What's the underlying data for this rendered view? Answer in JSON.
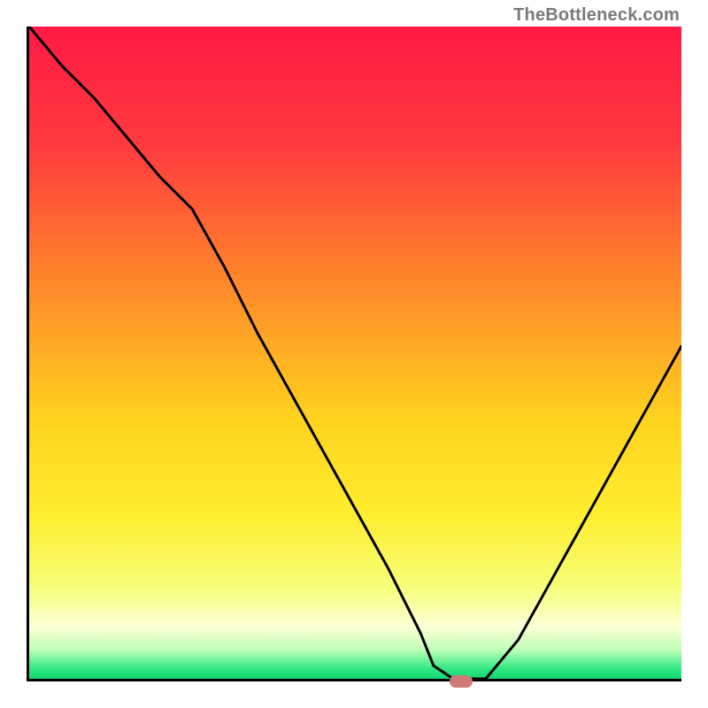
{
  "attribution": "TheBottleneck.com",
  "chart_data": {
    "type": "line",
    "title": "",
    "xlabel": "",
    "ylabel": "",
    "xlim": [
      0,
      100
    ],
    "ylim": [
      0,
      100
    ],
    "x": [
      0,
      5,
      10,
      15,
      20,
      25,
      30,
      35,
      40,
      45,
      50,
      55,
      60,
      62,
      65,
      67,
      70,
      75,
      80,
      85,
      90,
      95,
      100
    ],
    "values": [
      100,
      94,
      89,
      83,
      77,
      72,
      63,
      53,
      44,
      35,
      26,
      17,
      7,
      2,
      0,
      0,
      0,
      6,
      15,
      24,
      33,
      42,
      51
    ],
    "marker": {
      "x": 66,
      "y": 0,
      "color": "#cf7a78"
    },
    "gradient_stops": [
      {
        "offset": 0.0,
        "color": "#ff1a44"
      },
      {
        "offset": 0.18,
        "color": "#ff3a3f"
      },
      {
        "offset": 0.4,
        "color": "#ff8a2a"
      },
      {
        "offset": 0.6,
        "color": "#ffd21e"
      },
      {
        "offset": 0.75,
        "color": "#ffee30"
      },
      {
        "offset": 0.86,
        "color": "#f6ff7a"
      },
      {
        "offset": 0.92,
        "color": "#fdffd6"
      },
      {
        "offset": 0.955,
        "color": "#bfffb7"
      },
      {
        "offset": 0.985,
        "color": "#2fe783"
      },
      {
        "offset": 1.0,
        "color": "#15d871"
      }
    ]
  },
  "colors": {
    "curve": "#000000",
    "frame": "#000000",
    "attribution": "#7a7a7a"
  }
}
